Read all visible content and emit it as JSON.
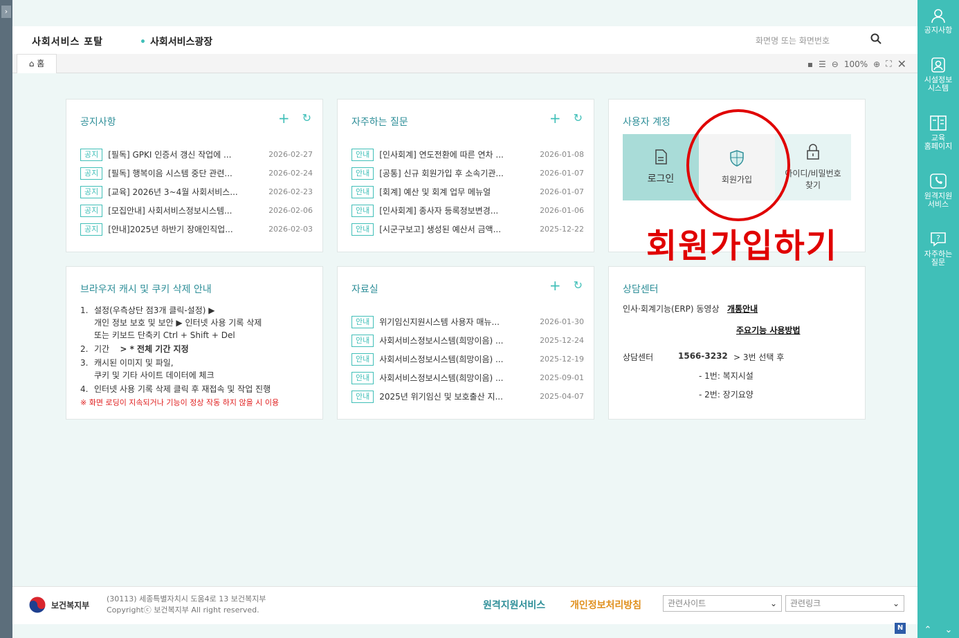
{
  "header": {
    "brand": "사회서비스 포탈",
    "crumb": "사회서비스광장",
    "search_placeholder": "화면명 또는 화면번호"
  },
  "tabbar": {
    "home_tab": "홈",
    "zoom": "100%"
  },
  "right_nav": [
    {
      "label1": "공지사항",
      "label2": ""
    },
    {
      "label1": "시설정보",
      "label2": "시스템"
    },
    {
      "label1": "교육",
      "label2": "홈페이지"
    },
    {
      "label1": "원격지원",
      "label2": "서비스"
    },
    {
      "label1": "자주하는",
      "label2": "질문"
    }
  ],
  "notice": {
    "title": "공지사항",
    "items": [
      {
        "badge": "공지",
        "text": "[필독] GPKI 인증서 갱신 작업에 ...",
        "date": "2026-02-27"
      },
      {
        "badge": "공지",
        "text": "[필독] 행복이음 시스템 중단 관련...",
        "date": "2026-02-24"
      },
      {
        "badge": "공지",
        "text": "[교육] 2026년 3~4월 사회서비스...",
        "date": "2026-02-23"
      },
      {
        "badge": "공지",
        "text": "[모집안내] 사회서비스정보시스템...",
        "date": "2026-02-06"
      },
      {
        "badge": "공지",
        "text": "[안내]2025년 하반기 장애인직업...",
        "date": "2026-02-03"
      }
    ]
  },
  "faq": {
    "title": "자주하는 질문",
    "items": [
      {
        "badge": "안내",
        "text": "[인사회계] 연도전환에 따른 연차 ...",
        "date": "2026-01-08"
      },
      {
        "badge": "안내",
        "text": "[공통] 신규 회원가입 후 소속기관...",
        "date": "2026-01-07"
      },
      {
        "badge": "안내",
        "text": "[회계] 예산 및 회계 업무 메뉴얼",
        "date": "2026-01-07"
      },
      {
        "badge": "안내",
        "text": "[인사회계] 종사자 등록정보변경...",
        "date": "2026-01-06"
      },
      {
        "badge": "안내",
        "text": "[시군구보고] 생성된 예산서 금액...",
        "date": "2025-12-22"
      }
    ]
  },
  "account": {
    "title": "사용자 계정",
    "login": "로그인",
    "join": "회원가입",
    "find1": "아이디/비밀번호",
    "find2": "찾기",
    "annotation": "회원가입하기"
  },
  "cache": {
    "title": "브라우저 캐시 및 쿠키 삭제 안내",
    "l1_num": "1.",
    "l1a": "설정(우측상단 점3개 클릭-설정) ▶",
    "l1b": "개인 정보 보호 및 보안 ▶ 인터넷 사용 기록 삭제",
    "l1c": "또는 키보드 단축키 Ctrl + Shift + Del",
    "l2_num": "2.",
    "l2a": "기간",
    "l2b": "> * 전체 기간 지정",
    "l3_num": "3.",
    "l3a": "캐시된 이미지 및 파일,",
    "l3b": "쿠키 및 기타 사이트 데이터에 체크",
    "l4_num": "4.",
    "l4a": "인터넷 사용 기록 삭제 클릭 후 재접속 및 작업 진행",
    "warn": "※ 화면 로딩이 지속되거나 기능이 정상 작동 하지 않을 시 이용"
  },
  "archive": {
    "title": "자료실",
    "items": [
      {
        "badge": "안내",
        "text": "위기임신지원시스템 사용자 매뉴...",
        "date": "2026-01-30"
      },
      {
        "badge": "안내",
        "text": "사회서비스정보시스템(희망이음) ...",
        "date": "2025-12-24"
      },
      {
        "badge": "안내",
        "text": "사회서비스정보시스템(희망이음) ...",
        "date": "2025-12-19"
      },
      {
        "badge": "안내",
        "text": "사회서비스정보시스템(희망이음) ...",
        "date": "2025-09-01"
      },
      {
        "badge": "안내",
        "text": "2025년 위기임신 및 보호출산 지...",
        "date": "2025-04-07"
      }
    ]
  },
  "consult": {
    "title": "상담센터",
    "erp": "인사·회계기능(ERP) 동영상",
    "link1": "개통안내",
    "link2": "주요기능 사용방법",
    "center": "상담센터",
    "phone": "1566-3232",
    "after": "> 3번 선택 후",
    "opt1": "- 1번: 복지시설",
    "opt2": "- 2번: 장기요양"
  },
  "footer": {
    "org": "보건복지부",
    "addr1": "(30113) 세종특별자치시 도움4로 13 보건복지부",
    "addr2": "Copyrightⓒ 보건복지부 All right reserved.",
    "remote": "원격지원서비스",
    "privacy": "개인정보처리방침",
    "sel1": "관련사이트",
    "sel2": "관련링크"
  },
  "colors": {
    "accent": "#40bfb8",
    "title": "#2f8f99",
    "warn": "#e02020",
    "privacy": "#e0901e"
  }
}
